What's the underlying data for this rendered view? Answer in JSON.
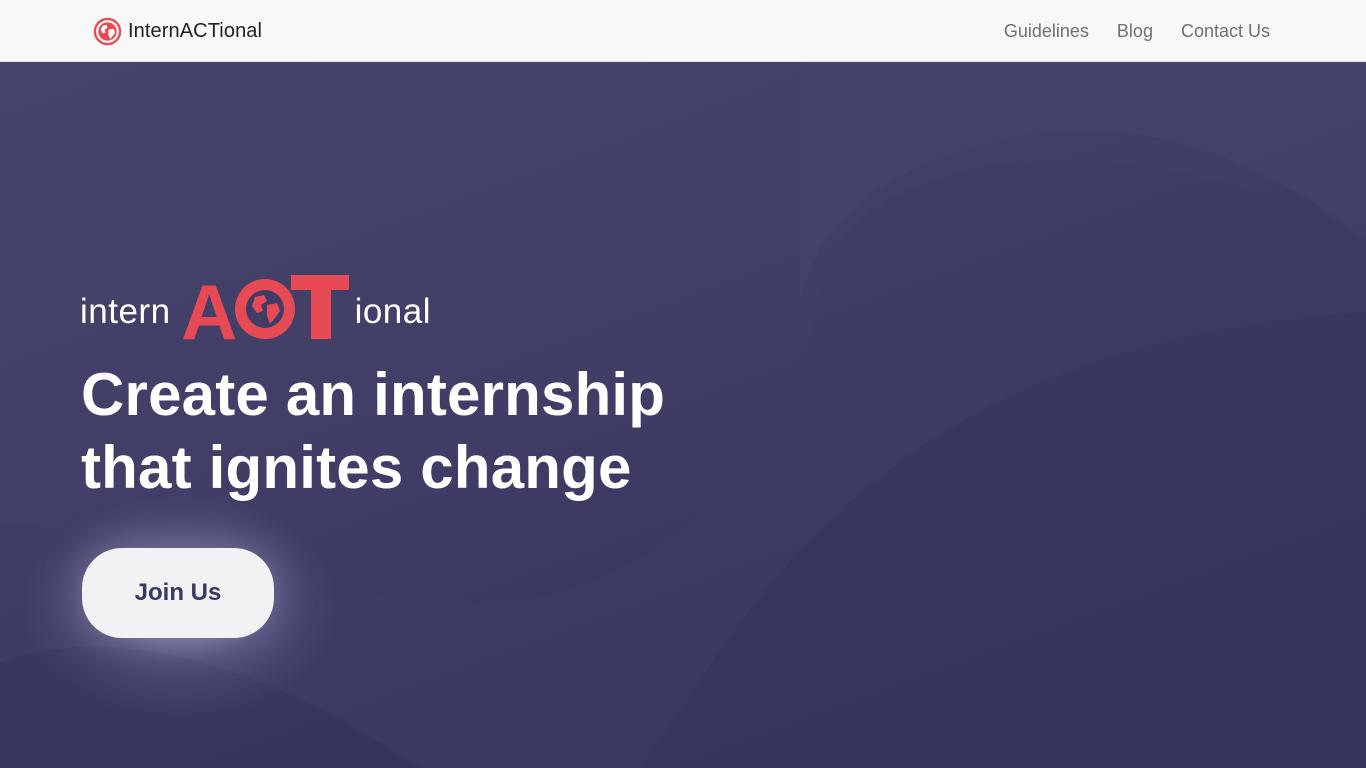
{
  "navbar": {
    "brand": "InternACTional",
    "links": [
      "Guidelines",
      "Blog",
      "Contact Us"
    ]
  },
  "hero": {
    "logo": {
      "prefix": "intern",
      "highlight": "ACT",
      "suffix": "ional"
    },
    "title_line1": "Create an internship",
    "title_line2": "that ignites change",
    "cta_label": "Join Us"
  },
  "colors": {
    "accent": "#e84a55",
    "hero_background": "#3f3d65",
    "navbar_background": "#f8f8f8",
    "button_text": "#3a3962"
  },
  "icons": [
    "globe-icon"
  ]
}
